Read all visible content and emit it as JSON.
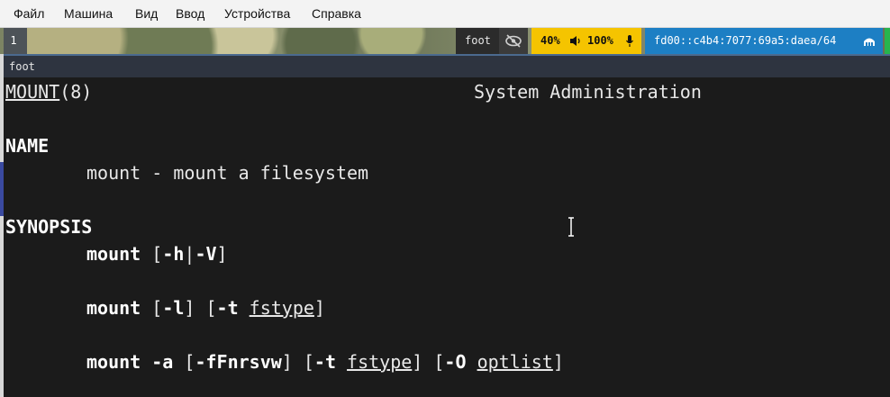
{
  "menubar": {
    "items": [
      "Файл",
      "Машина",
      "Вид",
      "Ввод",
      "Устройства",
      "Справка"
    ]
  },
  "swaybar": {
    "workspace": "1",
    "app_label": "foot",
    "audio": {
      "volume": "40%",
      "mic": "100%"
    },
    "network": "fd00::c4b4:7077:69a5:daea/64",
    "icons": [
      "eye-slash-icon",
      "speaker-icon",
      "microphone-icon",
      "network-icon"
    ],
    "colors": {
      "audio": "#f5c400",
      "network": "#1d7fc4",
      "tail": "#27b54e"
    }
  },
  "window": {
    "title": "foot"
  },
  "man": {
    "header_left_name": "MOUNT",
    "header_left_section": "(8)",
    "header_center": "System Administration",
    "name_heading": "NAME",
    "name_line": "mount - mount a filesystem",
    "synopsis_heading": "SYNOPSIS",
    "syn1": {
      "cmd": "mount",
      "p1": " [",
      "opt1": "-h",
      "p2": "|",
      "opt2": "-V",
      "p3": "]"
    },
    "syn2": {
      "cmd": "mount",
      "p1": " [",
      "opt1": "-l",
      "p2": "] [",
      "opt2": "-t",
      "sp": " ",
      "arg": "fstype",
      "p3": "]"
    },
    "syn3": {
      "cmd": "mount",
      "sp0": " ",
      "opt0": "-a",
      "p1": " [",
      "opt1": "-fFnrsvw",
      "p2": "] [",
      "opt2": "-t",
      "sp": " ",
      "arg1": "fstype",
      "p3": "] [",
      "opt3": "-O",
      "sp2": " ",
      "arg2": "optlist",
      "p4": "]"
    }
  }
}
